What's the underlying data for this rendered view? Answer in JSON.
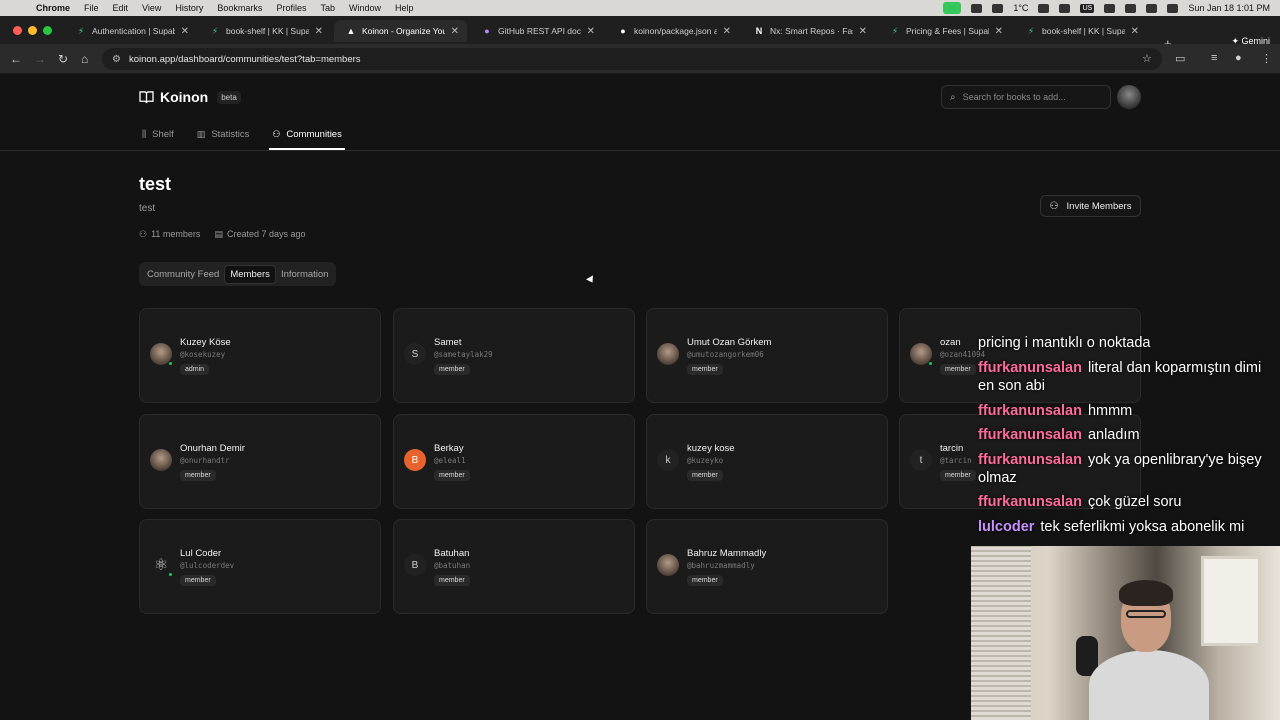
{
  "macos_menubar": {
    "app_name": "Chrome",
    "menus": [
      "File",
      "Edit",
      "View",
      "History",
      "Bookmarks",
      "Profiles",
      "Tab",
      "Window",
      "Help"
    ],
    "temperature": "1°C",
    "datetime": "Sun Jan 18  1:01 PM",
    "input_source": "US"
  },
  "browser": {
    "tabs": [
      {
        "title": "Authentication | Supabase",
        "icon": "supabase-icon"
      },
      {
        "title": "book-shelf | KK | Supabase",
        "icon": "supabase-icon"
      },
      {
        "title": "Koinon - Organize Your",
        "icon": "koinon-icon",
        "active": true
      },
      {
        "title": "GitHub REST API documentation",
        "icon": "github-docs-icon"
      },
      {
        "title": "koinon/package.json at",
        "icon": "github-icon"
      },
      {
        "title": "Nx: Smart Repos · Fast",
        "icon": "nx-icon"
      },
      {
        "title": "Pricing & Fees | Supabase",
        "icon": "supabase-icon"
      },
      {
        "title": "book-shelf | KK | Supabase",
        "icon": "supabase-icon"
      }
    ],
    "gemini_label": "Gemini",
    "url": "koinon.app/dashboard/communities/test?tab=members"
  },
  "app": {
    "brand": "Koinon",
    "beta_badge": "beta",
    "search_placeholder": "Search for books to add...",
    "nav_tabs": [
      {
        "label": "Shelf",
        "icon": "books-icon"
      },
      {
        "label": "Statistics",
        "icon": "bar-chart-icon"
      },
      {
        "label": "Communities",
        "icon": "users-icon",
        "active": true
      }
    ]
  },
  "community": {
    "name": "test",
    "description": "test",
    "members_count": "11 members",
    "created": "Created 7 days ago",
    "invite_label": "Invite Members",
    "sub_tabs": [
      {
        "label": "Community Feed"
      },
      {
        "label": "Members",
        "active": true
      },
      {
        "label": "Information"
      }
    ]
  },
  "members": [
    {
      "name": "Kuzey Köse",
      "handle": "@kosekuzey",
      "role": "admin",
      "avatar": "photo",
      "online": true
    },
    {
      "name": "Samet",
      "handle": "@sametaylak29",
      "role": "member",
      "avatar": "S",
      "online": false
    },
    {
      "name": "Umut Ozan Görkem",
      "handle": "@umutozangorkem06",
      "role": "member",
      "avatar": "photo",
      "online": false
    },
    {
      "name": "ozan",
      "handle": "@ozan41094",
      "role": "member",
      "avatar": "photo",
      "online": true
    },
    {
      "name": "Onurhan Demir",
      "handle": "@onurhandtr",
      "role": "member",
      "avatar": "photo",
      "online": false
    },
    {
      "name": "Berkay",
      "handle": "@eleal1",
      "role": "member",
      "avatar": "B",
      "avatar_color": "#e8622c",
      "online": false
    },
    {
      "name": "kuzey kose",
      "handle": "@kuzeyko",
      "role": "member",
      "avatar": "k",
      "online": false
    },
    {
      "name": "tarcin",
      "handle": "@tarcin",
      "role": "member",
      "avatar": "t",
      "online": false
    },
    {
      "name": "Lul Coder",
      "handle": "@lulcoderdev",
      "role": "member",
      "avatar": "atom",
      "online": true
    },
    {
      "name": "Batuhan",
      "handle": "@batuhan",
      "role": "member",
      "avatar": "B",
      "online": false
    },
    {
      "name": "Bahruz Mammadly",
      "handle": "@bahruzmammadly",
      "role": "member",
      "avatar": "photo",
      "online": false
    }
  ],
  "stream_chat": [
    {
      "user": "",
      "text": "pricing i mantıklı o noktada",
      "color": "#ffffff"
    },
    {
      "user": "ffurkanunsalan",
      "text": "literal dan koparmıştın dimi en son abi",
      "color": "#ff6b9a"
    },
    {
      "user": "ffurkanunsalan",
      "text": "hmmm",
      "color": "#ff6b9a"
    },
    {
      "user": "ffurkanunsalan",
      "text": "anladım",
      "color": "#ff6b9a"
    },
    {
      "user": "ffurkanunsalan",
      "text": "yok ya openlibrary'ye bişey olmaz",
      "color": "#ff6b9a"
    },
    {
      "user": "ffurkanunsalan",
      "text": "çok güzel soru",
      "color": "#ff6b9a"
    },
    {
      "user": "lulcoder",
      "text": "tek seferlikmi yoksa abonelik mi",
      "color": "#c792ff"
    }
  ]
}
